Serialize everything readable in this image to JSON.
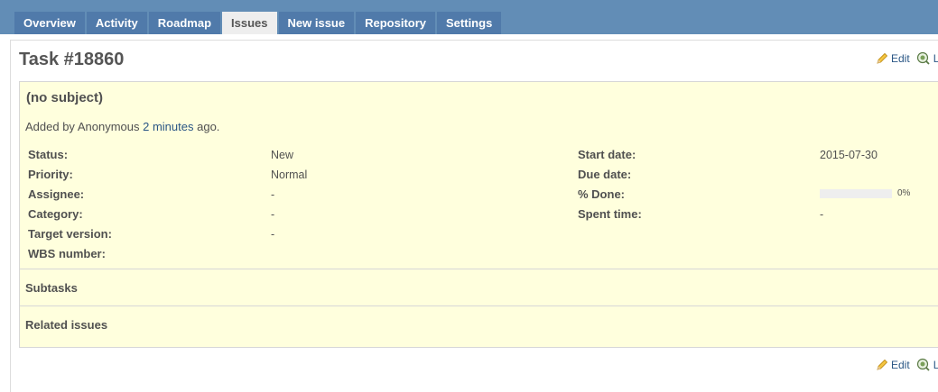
{
  "tabs": [
    {
      "label": "Overview"
    },
    {
      "label": "Activity"
    },
    {
      "label": "Roadmap"
    },
    {
      "label": "Issues"
    },
    {
      "label": "New issue"
    },
    {
      "label": "Repository"
    },
    {
      "label": "Settings"
    }
  ],
  "issue": {
    "title": "Task #18860",
    "subject": "(no subject)",
    "added_by_prefix": "Added by Anonymous",
    "added_time_link": "2 minutes",
    "added_suffix": "ago."
  },
  "contextual": {
    "edit_label": "Edit",
    "watch_label_cut": "L",
    "icons": [
      "pencil-icon",
      "watch-icon"
    ]
  },
  "attributes": {
    "status": {
      "label": "Status:",
      "value": "New"
    },
    "priority": {
      "label": "Priority:",
      "value": "Normal"
    },
    "assignee": {
      "label": "Assignee:",
      "value": "-"
    },
    "category": {
      "label": "Category:",
      "value": "-"
    },
    "target_version": {
      "label": "Target version:",
      "value": "-"
    },
    "wbs_number": {
      "label": "WBS number:",
      "value": ""
    },
    "start_date": {
      "label": "Start date:",
      "value": "2015-07-30"
    },
    "due_date": {
      "label": "Due date:",
      "value": ""
    },
    "done": {
      "label": "% Done:",
      "value": "0%",
      "fraction": 0
    },
    "spent_time": {
      "label": "Spent time:",
      "value": "-"
    }
  },
  "sections": {
    "subtasks": "Subtasks",
    "related": "Related issues"
  },
  "colors": {
    "header": "#628db6",
    "tab": "#507aaa",
    "tab_selected": "#eeeeee",
    "issue_bg": "#ffffdd",
    "link": "#2a5685"
  }
}
